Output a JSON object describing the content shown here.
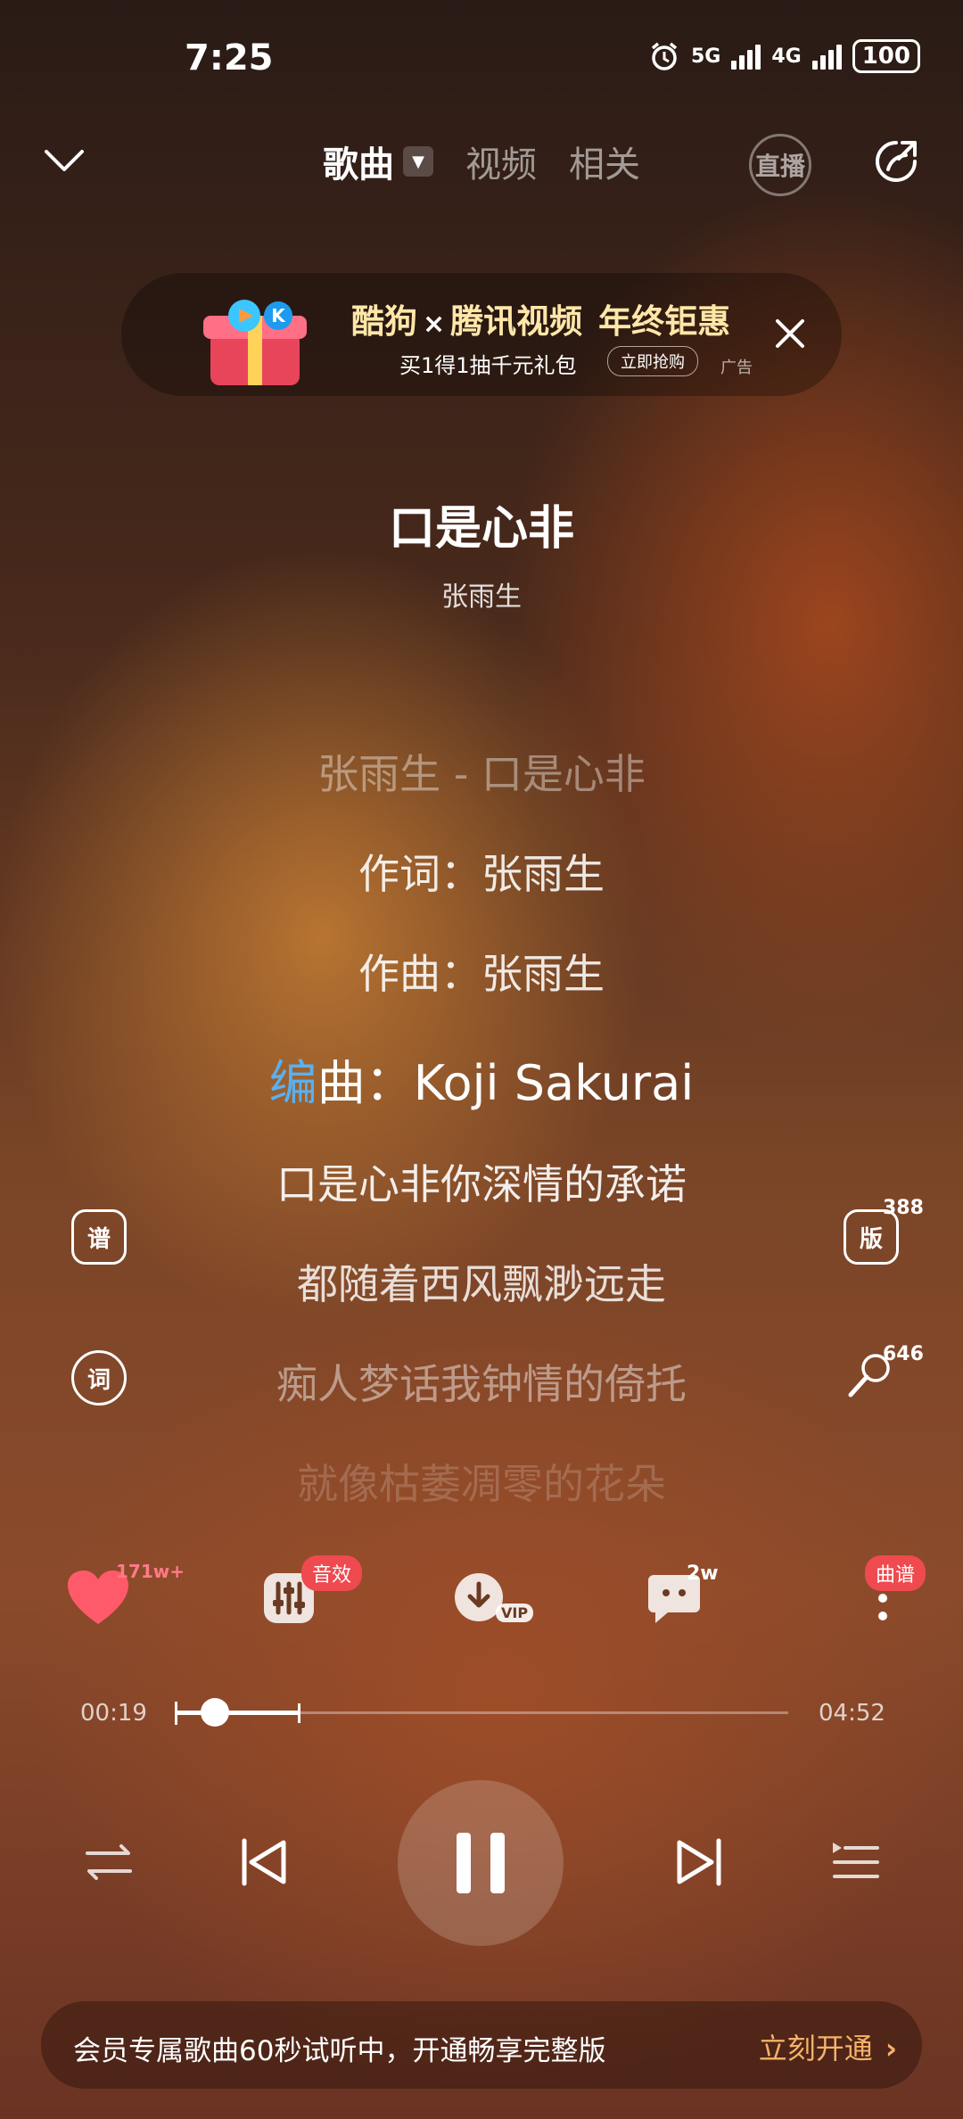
{
  "status_bar": {
    "time": "7:25",
    "net1": "5G",
    "net2": "4G",
    "battery": "100"
  },
  "nav": {
    "tabs": [
      "歌曲",
      "视频",
      "相关"
    ],
    "live_label": "直播"
  },
  "ad": {
    "brand1": "酷狗",
    "x": "×",
    "brand2": "腾讯视频",
    "promo": "年终钜惠",
    "subtitle": "买1得1抽千元礼包",
    "cta": "立即抢购",
    "tag": "广告"
  },
  "song": {
    "title": "口是心非",
    "artist": "张雨生"
  },
  "lyrics": {
    "l0": "张雨生 - 口是心非",
    "l1": "作词：张雨生",
    "l2": "作曲：张雨生",
    "l3_hl": "编",
    "l3_rest": "曲：Koji Sakurai",
    "l4": "口是心非你深情的承诺",
    "l5": "都随着西风飘渺远走",
    "l6": "痴人梦话我钟情的倚托",
    "l7": "就像枯萎凋零的花朵"
  },
  "side": {
    "pu": "谱",
    "ci": "词",
    "ban": "版",
    "ban_count": "388",
    "mic_count": "646"
  },
  "actions": {
    "like_count": "171w+",
    "effect_badge": "音效",
    "download_tag": "VIP",
    "comment_count": "2w",
    "score_badge": "曲谱"
  },
  "player": {
    "current_time": "00:19",
    "total_time": "04:52",
    "progress": 0.065,
    "buffered": 0.2
  },
  "vip": {
    "text": "会员专属歌曲60秒试听中，开通畅享完整版",
    "cta": "立刻开通"
  },
  "colors": {
    "accent_blue": "#5ab0f0",
    "vip_cta": "#f5b26a",
    "badge_red": "#ee4a4f",
    "heart": "#ff5a6a"
  }
}
